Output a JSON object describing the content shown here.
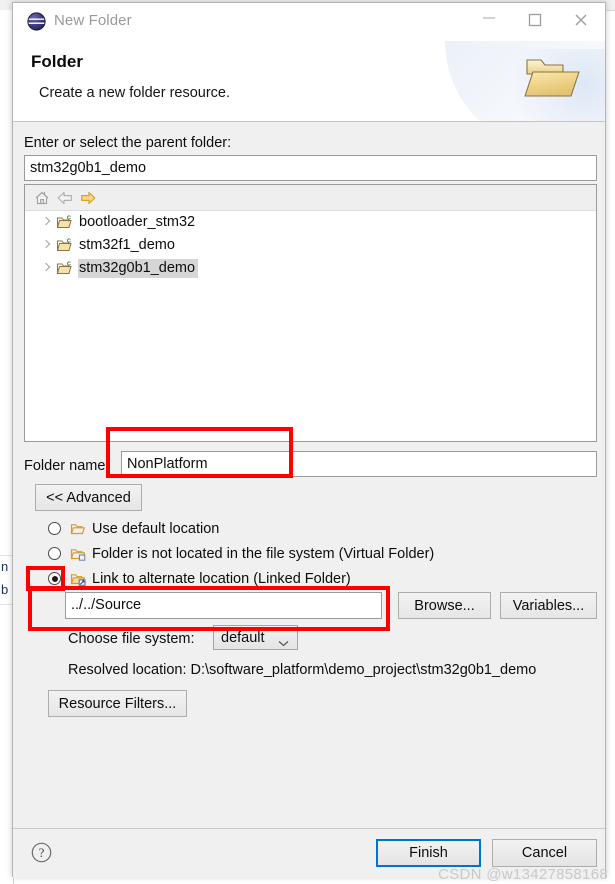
{
  "window": {
    "title": "New Folder",
    "app_icon": "eclipse-globe-icon",
    "controls": {
      "minimize": "minimize-icon",
      "maximize": "maximize-icon",
      "close": "close-icon"
    }
  },
  "header": {
    "title": "Folder",
    "subtitle": "Create a new folder resource.",
    "icon": "open-folder-icon"
  },
  "parent_folder": {
    "label": "Enter or select the parent folder:",
    "value": "stm32g0b1_demo",
    "placeholder": ""
  },
  "tree": {
    "toolbar": [
      {
        "icon": "home-icon",
        "name": "tree-home-button"
      },
      {
        "icon": "back-arrow-icon",
        "name": "tree-back-button"
      },
      {
        "icon": "forward-arrow-icon",
        "name": "tree-forward-button"
      }
    ],
    "items": [
      {
        "label": "bootloader_stm32",
        "icon": "c-project-folder-icon",
        "selected": false,
        "expandable": true
      },
      {
        "label": "stm32f1_demo",
        "icon": "c-project-folder-icon",
        "selected": false,
        "expandable": true
      },
      {
        "label": "stm32g0b1_demo",
        "icon": "c-project-folder-icon",
        "selected": true,
        "expandable": true
      }
    ]
  },
  "folder_name": {
    "label": "Folder name:",
    "value": "NonPlatform"
  },
  "advanced": {
    "toggle_label": "<< Advanced",
    "options": [
      {
        "label": "Use default location",
        "icon": "folder-open-icon",
        "selected": false
      },
      {
        "label": "Folder is not located in the file system (Virtual Folder)",
        "icon": "virtual-folder-icon",
        "selected": false
      },
      {
        "label": "Link to alternate location (Linked Folder)",
        "icon": "linked-folder-icon",
        "selected": true
      }
    ],
    "link_path": "../../Source",
    "browse_label": "Browse...",
    "variables_label": "Variables...",
    "file_system_label": "Choose file system:",
    "file_system_value": "default",
    "resolved_label": "Resolved location:",
    "resolved_value": "D:\\software_platform\\demo_project\\stm32g0b1_demo",
    "resource_filters_label": "Resource Filters..."
  },
  "footer": {
    "help_icon": "help-question-icon",
    "finish_label": "Finish",
    "cancel_label": "Cancel"
  },
  "annotations": {
    "color": "#fe0000",
    "boxes": [
      {
        "name": "folder-name-highlight"
      },
      {
        "name": "linked-folder-radio-highlight"
      },
      {
        "name": "link-path-highlight"
      }
    ]
  },
  "watermark": "CSDN @w13427858168",
  "background_fragments": [
    "n",
    "b"
  ]
}
